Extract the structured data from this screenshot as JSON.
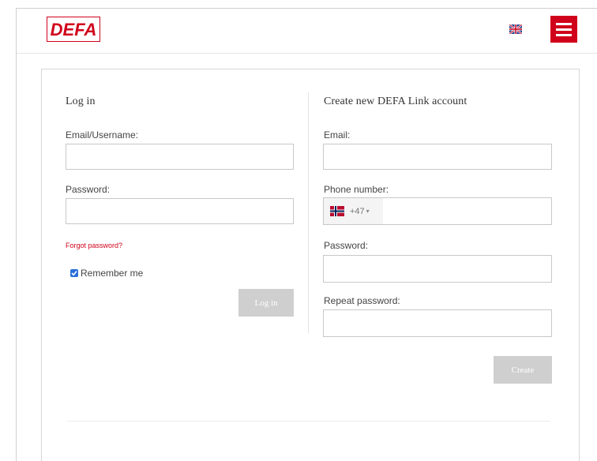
{
  "header": {
    "logo_text": "DEFA",
    "language_icon": "uk-flag-icon",
    "menu_icon": "hamburger-menu-icon",
    "brand_color": "#d0021b"
  },
  "login": {
    "title": "Log in",
    "email_label": "Email/Username:",
    "email_value": "",
    "password_label": "Password:",
    "password_value": "",
    "forgot_label": "Forgot password?",
    "remember_label": "Remember me",
    "remember_checked": true,
    "submit_label": "Log in"
  },
  "register": {
    "title": "Create new DEFA Link account",
    "email_label": "Email:",
    "email_value": "",
    "phone_label": "Phone number:",
    "phone_country_icon": "norway-flag-icon",
    "phone_code": "+47",
    "phone_value": "",
    "password_label": "Password:",
    "password_value": "",
    "repeat_password_label": "Repeat password:",
    "repeat_password_value": "",
    "submit_label": "Create"
  },
  "colors": {
    "accent": "#d0021b",
    "disabled_button": "#cfcfcf",
    "checkbox": "#2a6fdb"
  }
}
